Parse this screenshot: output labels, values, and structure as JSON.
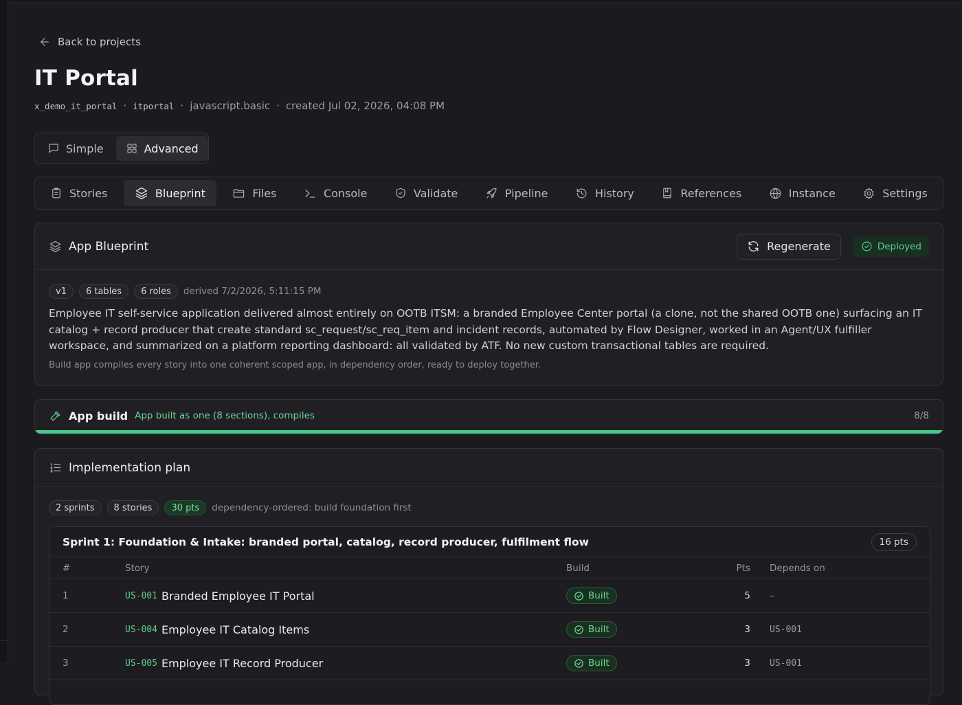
{
  "nav": {
    "back_label": "Back to projects"
  },
  "project": {
    "title": "IT Portal",
    "scope": "x_demo_it_portal",
    "prefix": "itportal",
    "template": "javascript.basic",
    "created": "created Jul 02, 2026, 04:08 PM",
    "sep": "·"
  },
  "mode": {
    "simple_label": "Simple",
    "advanced_label": "Advanced",
    "active": "advanced"
  },
  "tabs": [
    {
      "label": "Stories",
      "icon": "clipboard-icon"
    },
    {
      "label": "Blueprint",
      "icon": "layers-icon",
      "active": true
    },
    {
      "label": "Files",
      "icon": "folder-icon"
    },
    {
      "label": "Console",
      "icon": "terminal-icon"
    },
    {
      "label": "Validate",
      "icon": "shield-check-icon"
    },
    {
      "label": "Pipeline",
      "icon": "rocket-icon"
    },
    {
      "label": "History",
      "icon": "history-icon"
    },
    {
      "label": "References",
      "icon": "book-icon"
    },
    {
      "label": "Instance",
      "icon": "globe-icon"
    },
    {
      "label": "Settings",
      "icon": "gear-icon"
    }
  ],
  "blueprint": {
    "title": "App Blueprint",
    "regenerate_label": "Regenerate",
    "status": "Deployed",
    "version": "v1",
    "tables": "6 tables",
    "roles": "6 roles",
    "derived": "derived 7/2/2026, 5:11:15 PM",
    "description": "Employee IT self-service application delivered almost entirely on OOTB ITSM: a branded Employee Center portal (a clone, not the shared OOTB one) surfacing an IT catalog + record producer that create standard sc_request/sc_req_item and incident records, automated by Flow Designer, worked in an Agent/UX fulfiller workspace, and summarized on a platform reporting dashboard: all validated by ATF. No new custom transactional tables are required.",
    "note": "Build app compiles every story into one coherent scoped app, in dependency order, ready to deploy together."
  },
  "build": {
    "title": "App build",
    "summary": "App built as one (8 sections), compiles",
    "count": "8/8",
    "progress": 1.0,
    "accent": "#47c98a"
  },
  "plan": {
    "title": "Implementation plan",
    "sprints_count": "2 sprints",
    "stories_count": "8 stories",
    "points": "30 pts",
    "ordering": "dependency-ordered: build foundation first",
    "columns": {
      "num": "#",
      "story": "Story",
      "build": "Build",
      "pts": "Pts",
      "depends": "Depends on"
    },
    "sprint1": {
      "title": "Sprint 1: Foundation & Intake: branded portal, catalog, record producer, fulfilment flow",
      "points": "16 pts",
      "rows": [
        {
          "num": "1",
          "id": "US-001",
          "title": "Branded Employee IT Portal",
          "build": "Built",
          "pts": "5",
          "depends": "–"
        },
        {
          "num": "2",
          "id": "US-004",
          "title": "Employee IT Catalog Items",
          "build": "Built",
          "pts": "3",
          "depends": "US-001"
        },
        {
          "num": "3",
          "id": "US-005",
          "title": "Employee IT Record Producer",
          "build": "Built",
          "pts": "3",
          "depends": "US-001"
        }
      ]
    }
  }
}
